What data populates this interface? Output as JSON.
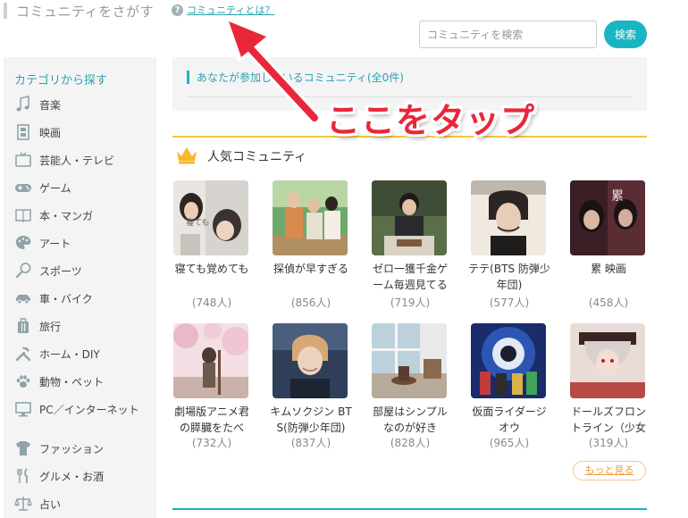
{
  "header": {
    "title": "コミュニティをさがす",
    "help_icon_glyph": "?",
    "help_link": "コミュニティとは？"
  },
  "search": {
    "placeholder": "コミュニティを検索",
    "button_label": "検索"
  },
  "sidebar": {
    "heading": "カテゴリから探す",
    "items": [
      {
        "label": "音楽",
        "icon": "music-note-icon"
      },
      {
        "label": "映画",
        "icon": "film-icon"
      },
      {
        "label": "芸能人・テレビ",
        "icon": "tv-icon"
      },
      {
        "label": "ゲーム",
        "icon": "gamepad-icon"
      },
      {
        "label": "本・マンガ",
        "icon": "book-icon"
      },
      {
        "label": "アート",
        "icon": "palette-icon"
      },
      {
        "label": "スポーツ",
        "icon": "tennis-racket-icon"
      },
      {
        "label": "車・バイク",
        "icon": "car-icon"
      },
      {
        "label": "旅行",
        "icon": "suitcase-icon"
      },
      {
        "label": "ホーム・DIY",
        "icon": "tools-icon"
      },
      {
        "label": "動物・ペット",
        "icon": "paw-icon"
      },
      {
        "label": "PC／インターネット",
        "icon": "monitor-icon"
      },
      {
        "label": "ファッション",
        "icon": "tshirt-icon"
      },
      {
        "label": "グルメ・お酒",
        "icon": "fork-knife-icon"
      },
      {
        "label": "占い",
        "icon": "scales-icon"
      }
    ]
  },
  "joined": {
    "text": "あなたが参加しているコミュニティ(全0件)"
  },
  "annotation": {
    "text": "ここをタップ",
    "color": "#e8283a"
  },
  "popular": {
    "title": "人気コミュニティ",
    "communities": [
      {
        "name": "寝ても覚めても",
        "count": "(748人)"
      },
      {
        "name": "探偵が早すぎる",
        "count": "(856人)"
      },
      {
        "name": "ゼロ一獲千金ゲーム毎週見てる",
        "count": "(719人)"
      },
      {
        "name": "テテ(BTS 防弾少年団)",
        "count": "(577人)"
      },
      {
        "name": "累 映画",
        "count": "(458人)"
      },
      {
        "name": "劇場版アニメ君の膵臓をたべ",
        "count": "(732人)"
      },
      {
        "name": "キムソクジン BTS(防弾少年団)",
        "count": "(837人)"
      },
      {
        "name": "部屋はシンプルなのが好き",
        "count": "(828人)"
      },
      {
        "name": "仮面ライダージオウ",
        "count": "(965人)"
      },
      {
        "name": "ドールズフロントライン（少女",
        "count": "(319人)"
      }
    ],
    "more_label": "もっと見る"
  },
  "colors": {
    "accent": "#17b6c2",
    "link": "#2d9fb3",
    "popular_divider": "#f5c53a",
    "more": "#f29a38"
  }
}
